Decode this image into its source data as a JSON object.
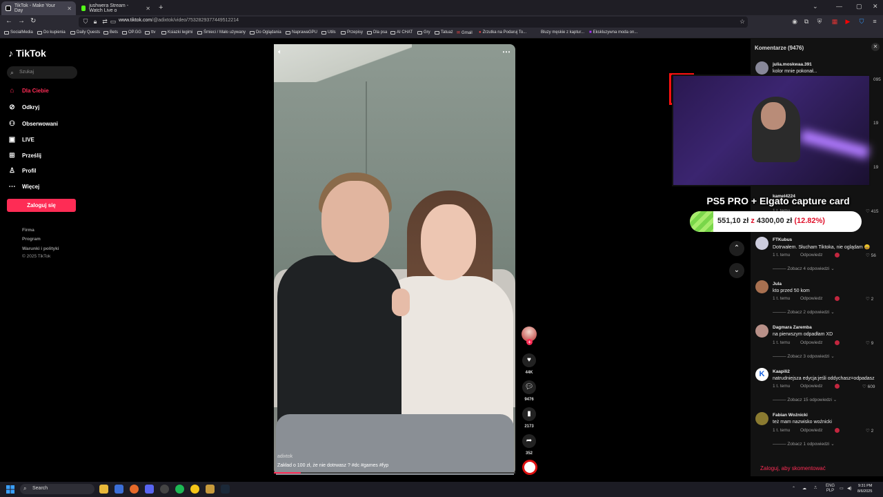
{
  "browser": {
    "tabs": [
      {
        "title": "TikTok - Make Your Day"
      },
      {
        "title": "jushwera Stream - Watch Live o"
      }
    ],
    "url_host": "www.tiktok.com",
    "url_path": "/@adixtok/video/7532829377449512214",
    "bookmarks": [
      "SocialMedia",
      "Do kupienia",
      "Daily Quests",
      "Bets",
      "OP.GG",
      "ttv",
      "Ksiazki legimi",
      "Śmieci / Mało używany",
      "Do Oglądania",
      "NaprawaGPU",
      "Utils",
      "Przepisy",
      "Dla psa",
      "AI CHAT",
      "Gry",
      "Tatuaż",
      "Gmail",
      "Zrzutka na Podaruj To...",
      "Bluzy męskie z kaptur...",
      "Ekskluzywna moda on..."
    ]
  },
  "sidebar": {
    "logo": "TikTok",
    "search_placeholder": "Szukaj",
    "items": [
      {
        "label": "Dla Ciebie",
        "active": true
      },
      {
        "label": "Odkryj"
      },
      {
        "label": "Obserwowani"
      },
      {
        "label": "LIVE"
      },
      {
        "label": "Prześlij"
      },
      {
        "label": "Profil"
      },
      {
        "label": "Więcej"
      }
    ],
    "login_button": "Zaloguj się",
    "footer": [
      "Firma",
      "Program",
      "Warunki i polityki",
      "© 2025 TikTok"
    ]
  },
  "video": {
    "author": "adixtok",
    "caption": "Zakład o 100 zł, że nie dotrwasz ? #dc #games #fyp",
    "progress": 0.11
  },
  "actions": {
    "likes": "44K",
    "comments": "9476",
    "saves": "2173",
    "shares": "352"
  },
  "comments": {
    "title": "Komentarze (9476)",
    "reply_label": "Odpowiedz",
    "login_prompt": "Zaloguj, aby skomentować",
    "items": [
      {
        "user": "julia.moskwaa.391",
        "text": "kolor mnie pokonał..."
      },
      {
        "user": "kamel4224",
        "text": "",
        "meta": "1 t. temu",
        "likes": "415"
      },
      {
        "user": "FTKubus",
        "text": "Dotrwałem. Słucham Tiktoka, nie oglądam 😄",
        "meta": "1 t. temu",
        "likes": "56",
        "more": "Zobacz 4 odpowiedzi"
      },
      {
        "user": "Jula",
        "text": "kto przed 50 kom",
        "meta": "1 t. temu",
        "likes": "2",
        "more": "Zobacz 2 odpowiedzi"
      },
      {
        "user": "Dagmara Zaremba",
        "text": "na pierwszym odpadłam XD",
        "meta": "1 t. temu",
        "likes": "9",
        "more": "Zobacz 3 odpowiedzi"
      },
      {
        "user": "Kaapili2",
        "text": "natrudniejsza edycja:jeśli oddychasz=odpadasz",
        "meta": "1 t. temu",
        "likes": "609",
        "more": "Zobacz 15 odpowiedzi"
      },
      {
        "user": "Fabian Woźnicki",
        "text": "też mam nazwisko woźnicki",
        "meta": "1 t. temu",
        "likes": "2",
        "more": "Zobacz 1 odpowiedzi"
      }
    ],
    "partial_likes": [
      "095",
      "19",
      "19"
    ]
  },
  "stream_overlay": {
    "goal_title": "PS5 PRO + Elgato capture card",
    "current": "551,10 zł",
    "separator": "z",
    "target": "4300,00 zł",
    "percent": "(12.82%)",
    "fraction": 0.1282
  },
  "taskbar": {
    "search": "Search",
    "lang": "ENG",
    "lang2": "PLP",
    "time": "9:31 PM",
    "date": "8/6/2025"
  },
  "colors": {
    "accent": "#fe2c55",
    "panel": "#121212",
    "goal_fill": "#79d64a"
  }
}
